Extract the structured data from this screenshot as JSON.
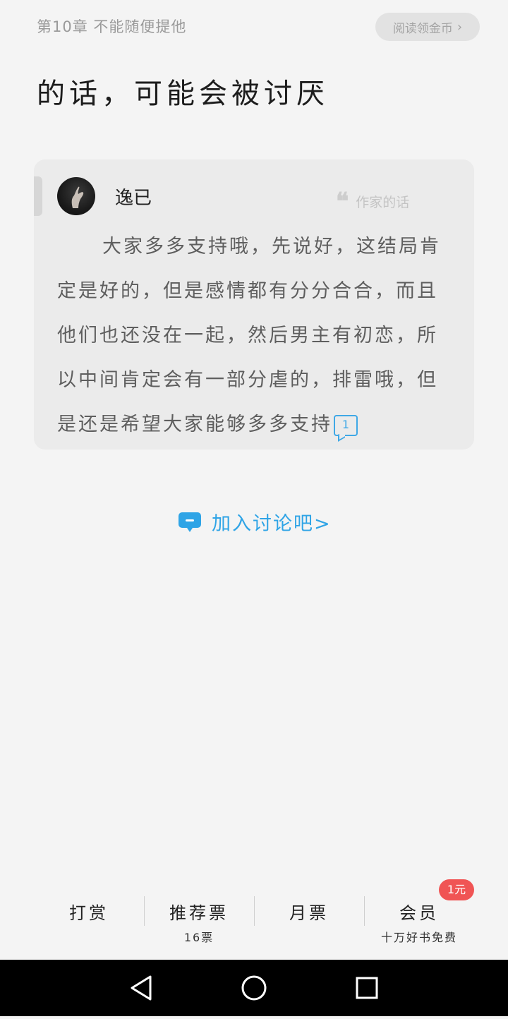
{
  "header": {
    "chapter_title": "第10章 不能随便提他",
    "coin_button": "阅读领金币"
  },
  "content": {
    "body_text": "的话，可能会被讨厌"
  },
  "author_note": {
    "author_name": "逸已",
    "tag": "作家的话",
    "text": "大家多多支持哦，先说好，这结局肯定是好的，但是感情都有分分合合，而且他们也还没在一起，然后男主有初恋，所以中间肯定会有一部分虐的，排雷哦，但是还是希望大家能够多多支持",
    "comment_count": "1"
  },
  "discussion": {
    "label": "加入讨论吧>"
  },
  "actions": {
    "tip": "打赏",
    "recommend": "推荐票",
    "recommend_count": "16票",
    "monthly": "月票",
    "vip": "会员",
    "vip_sub": "十万好书免费",
    "vip_badge": "1元"
  },
  "colors": {
    "accent": "#2fa4e6",
    "badge": "#f05454",
    "background": "#f4f4f4"
  },
  "system_nav": [
    "back-icon",
    "home-icon",
    "recents-icon"
  ]
}
